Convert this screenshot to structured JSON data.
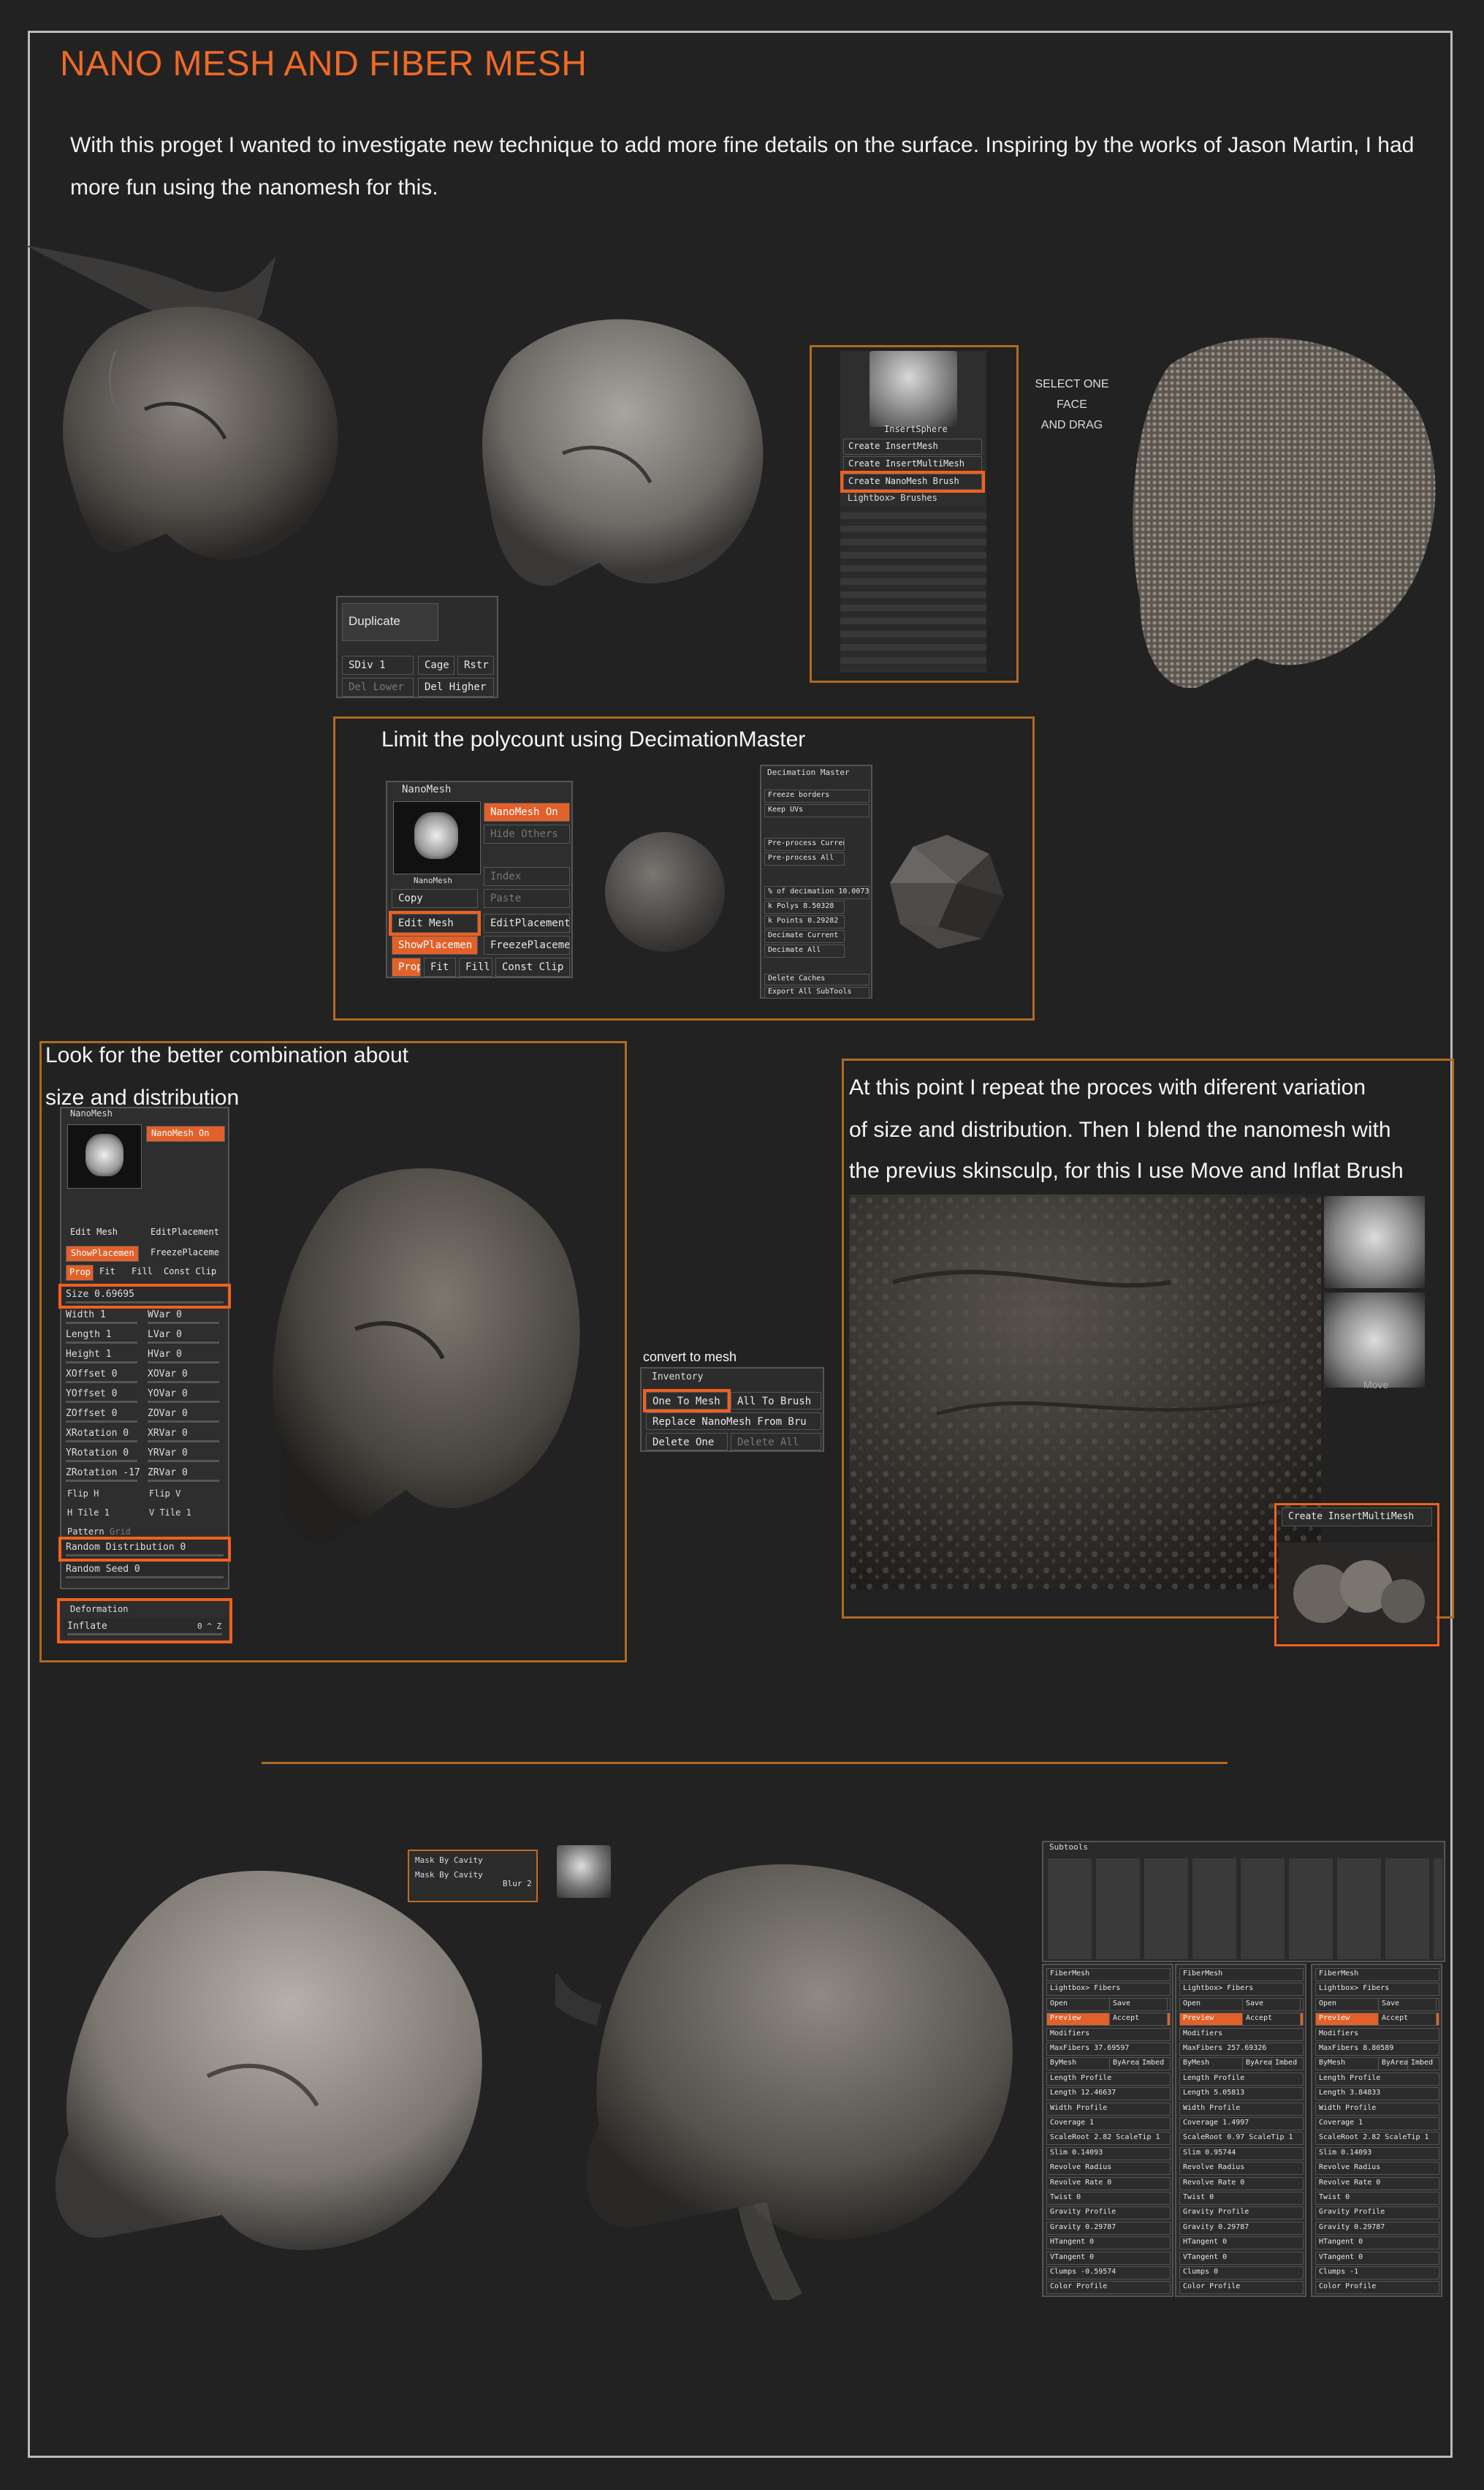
{
  "title": "NANO MESH AND FIBER MESH",
  "intro": "With this proget I wanted to investigate new technique to add more fine details on the surface. Inspiring by the works of Jason Martin, I had more fun using the nanomesh for this.",
  "section1": {
    "drag_note": [
      "SELECT ONE FACE",
      "AND DRAG"
    ],
    "duplicate_panel": {
      "duplicate": "Duplicate",
      "sdiv": "SDiv 1",
      "cage": "Cage",
      "rstr": "Rstr",
      "del_lower": "Del Lower",
      "del_higher": "Del Higher"
    },
    "insert_panel": {
      "header": "InsertSphere",
      "items": [
        "Create InsertMesh",
        "Create InsertMultiMesh",
        "Create NanoMesh Brush"
      ],
      "lightbox": "Lightbox> Brushes"
    }
  },
  "section2": {
    "caption": "Limit the polycount using DecimationMaster",
    "nanomesh_panel": {
      "header": "NanoMesh",
      "on": "NanoMesh On",
      "hide_others": "Hide Others",
      "thumb_label": "NanoMesh",
      "index": "Index",
      "copy": "Copy",
      "paste": "Paste",
      "edit_mesh": "Edit Mesh",
      "edit_placement": "EditPlacement",
      "show_placement": "ShowPlacemen",
      "freeze_placement": "FreezePlaceme",
      "prop": "Prop",
      "fit": "Fit",
      "fill": "Fill",
      "const_clip": "Const Clip"
    },
    "decimation_panel": {
      "header": "Decimation Master",
      "items": [
        "Freeze borders",
        "Keep UVs",
        "Pre-process Current",
        "Pre-process All",
        "% of decimation 10.00734",
        "k Polys 8.50328",
        "k Points 0.29282",
        "Decimate Current",
        "Decimate All",
        "Delete Caches",
        "Export All SubTools"
      ]
    }
  },
  "section3": {
    "caption_line1": "Look for the better combination about",
    "caption_line2": "size and distribution",
    "panel": {
      "header": "NanoMesh",
      "on": "NanoMesh On",
      "thumb_label": "NanoMesh",
      "rows": [
        [
          "Edit Mesh",
          "EditPlacement"
        ],
        [
          "ShowPlacemen",
          "FreezePlaceme"
        ],
        [
          "Prop",
          "Fit",
          "Fill",
          "Const Clip"
        ]
      ],
      "size": "Size 0.69695",
      "sliders": [
        [
          "Width 1",
          "WVar 0"
        ],
        [
          "Length 1",
          "LVar 0"
        ],
        [
          "Height 1",
          "HVar 0"
        ],
        [
          "XOffset 0",
          "XOVar 0"
        ],
        [
          "YOffset 0",
          "YOVar 0"
        ],
        [
          "ZOffset 0",
          "ZOVar 0"
        ],
        [
          "XRotation 0",
          "XRVar 0"
        ],
        [
          "YRotation 0",
          "YRVar 0"
        ],
        [
          "ZRotation -17",
          "ZRVar 0"
        ]
      ],
      "flip_h": "Flip H",
      "flip_v": "Flip V",
      "h_tile": "H Tile 1",
      "v_tile": "V Tile 1",
      "pattern": "Pattern",
      "grid": "Grid",
      "random_distribution": "Random Distribution 0",
      "random_seed": "Random Seed 0",
      "deformation": "Deformation",
      "inflate": "Inflate",
      "inflate_val": "0 ^ Z"
    },
    "convert_label": "convert to mesh",
    "inventory": {
      "header": "Inventory",
      "one_to_mesh": "One To Mesh",
      "all_to_brush": "All To Brush",
      "replace": "Replace NanoMesh From Bru",
      "delete_one": "Delete One",
      "delete_all": "Delete All"
    }
  },
  "section4": {
    "caption": [
      "At this point I repeat the proces with diferent variation",
      "of size and distribution. Then I blend the nanomesh with",
      "the previus skinsculp, for this I use Move and Inflat Brush"
    ],
    "brush_label": "Move",
    "insert_multi": "Create InsertMultiMesh"
  },
  "section5": {
    "mask_panel": [
      "Mask By Cavity",
      "Mask By Cavity",
      "Blur 2"
    ],
    "fiber_header": "FiberMesh",
    "subtools_header": "Subtools",
    "columns": [
      {
        "max": "MaxFibers 37.69597",
        "length": "Length 12.46637",
        "coverage": "Coverage 1",
        "scale": "ScaleRoot 2.82 ScaleTip 1",
        "slim": "Slim 0.14093",
        "revolve": "Revolve Rate 0",
        "twist": "Twist 0",
        "gravity": "Gravity 0.29787",
        "ht": "HTangent 0",
        "vt": "VTangent 0",
        "clump": "Clumps -0.59574"
      },
      {
        "max": "MaxFibers 257.69326",
        "length": "Length 5.05813",
        "coverage": "Coverage 1.4997",
        "scale": "ScaleRoot 0.97 ScaleTip 1",
        "slim": "Slim 0.95744",
        "revolve": "Revolve Rate 0",
        "twist": "Twist 0",
        "gravity": "Gravity 0.29787",
        "ht": "HTangent 0",
        "vt": "VTangent 0",
        "clump": "Clumps 0"
      },
      {
        "max": "MaxFibers 8.80589",
        "length": "Length 3.84833",
        "coverage": "Coverage 1",
        "scale": "ScaleRoot 2.82 ScaleTip 1",
        "slim": "Slim 0.14093",
        "revolve": "Revolve Rate 0",
        "twist": "Twist 0",
        "gravity": "Gravity 0.29787",
        "ht": "HTangent 0",
        "vt": "VTangent 0",
        "clump": "Clumps -1"
      }
    ],
    "col_common": {
      "lightbox": "Lightbox> Fibers",
      "open": "Open",
      "save": "Save",
      "preview": "Preview",
      "accept": "Accept",
      "modifiers": "Modifiers",
      "bymesh": "ByMesh",
      "byarea": "ByArea",
      "imbed": "Imbed",
      "length_profile": "Length Profile",
      "width_profile": "Width Profile",
      "revolve_radius": "Revolve Radius",
      "gravity_profile": "Gravity Profile",
      "color_profile": "Color Profile"
    }
  }
}
